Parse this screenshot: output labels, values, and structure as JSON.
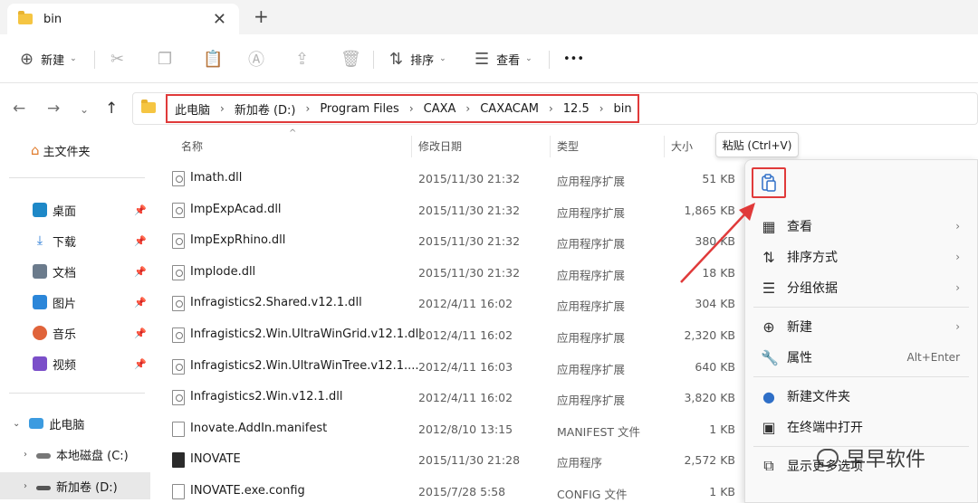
{
  "tab": {
    "title": "bin",
    "close": "✕",
    "new": "+"
  },
  "toolbar": {
    "new_label": "新建",
    "sort_label": "排序",
    "view_label": "查看",
    "more_label": "•••"
  },
  "breadcrumb": [
    "此电脑",
    "新加卷 (D:)",
    "Program Files",
    "CAXA",
    "CAXACAM",
    "12.5",
    "bin"
  ],
  "sidebar": {
    "home": "主文件夹",
    "pinned": [
      {
        "label": "桌面",
        "icon": "desktop-icon",
        "color": "#1e88c7"
      },
      {
        "label": "下载",
        "icon": "download-icon",
        "color": "#2a7bd6"
      },
      {
        "label": "文档",
        "icon": "document-icon",
        "color": "#6b7b8c"
      },
      {
        "label": "图片",
        "icon": "picture-icon",
        "color": "#2b86d9"
      },
      {
        "label": "音乐",
        "icon": "music-icon",
        "color": "#e0633a"
      },
      {
        "label": "视频",
        "icon": "video-icon",
        "color": "#7b4fc9"
      }
    ],
    "this_pc": "此电脑",
    "drives": [
      "本地磁盘 (C:)",
      "新加卷 (D:)"
    ]
  },
  "columns": {
    "name": "名称",
    "date": "修改日期",
    "type": "类型",
    "size": "大小"
  },
  "files": [
    {
      "name": "Imath.dll",
      "date": "2015/11/30 21:32",
      "type": "应用程序扩展",
      "size": "51 KB",
      "icon": "gear"
    },
    {
      "name": "ImpExpAcad.dll",
      "date": "2015/11/30 21:32",
      "type": "应用程序扩展",
      "size": "1,865 KB",
      "icon": "gear"
    },
    {
      "name": "ImpExpRhino.dll",
      "date": "2015/11/30 21:32",
      "type": "应用程序扩展",
      "size": "380 KB",
      "icon": "gear"
    },
    {
      "name": "Implode.dll",
      "date": "2015/11/30 21:32",
      "type": "应用程序扩展",
      "size": "18 KB",
      "icon": "gear"
    },
    {
      "name": "Infragistics2.Shared.v12.1.dll",
      "date": "2012/4/11 16:02",
      "type": "应用程序扩展",
      "size": "304 KB",
      "icon": "gear"
    },
    {
      "name": "Infragistics2.Win.UltraWinGrid.v12.1.dll",
      "date": "2012/4/11 16:02",
      "type": "应用程序扩展",
      "size": "2,320 KB",
      "icon": "gear"
    },
    {
      "name": "Infragistics2.Win.UltraWinTree.v12.1....",
      "date": "2012/4/11 16:03",
      "type": "应用程序扩展",
      "size": "640 KB",
      "icon": "gear"
    },
    {
      "name": "Infragistics2.Win.v12.1.dll",
      "date": "2012/4/11 16:02",
      "type": "应用程序扩展",
      "size": "3,820 KB",
      "icon": "gear"
    },
    {
      "name": "Inovate.AddIn.manifest",
      "date": "2012/8/10 13:15",
      "type": "MANIFEST 文件",
      "size": "1 KB",
      "icon": "doc"
    },
    {
      "name": "INOVATE",
      "date": "2015/11/30 21:28",
      "type": "应用程序",
      "size": "2,572 KB",
      "icon": "exe"
    },
    {
      "name": "INOVATE.exe.config",
      "date": "2015/7/28 5:58",
      "type": "CONFIG 文件",
      "size": "1 KB",
      "icon": "doc"
    }
  ],
  "context_menu": {
    "tooltip": "粘贴 (Ctrl+V)",
    "items": [
      {
        "label": "查看",
        "icon": "view-icon",
        "arrow": "›"
      },
      {
        "label": "排序方式",
        "icon": "sort-icon",
        "arrow": "›"
      },
      {
        "label": "分组依据",
        "icon": "group-icon",
        "arrow": "›"
      },
      {
        "label": "新建",
        "icon": "new-icon",
        "arrow": "›"
      },
      {
        "label": "属性",
        "icon": "properties-icon",
        "accel": "Alt+Enter"
      },
      {
        "label": "新建文件夹",
        "icon": "new-folder-icon"
      },
      {
        "label": "在终端中打开",
        "icon": "terminal-icon"
      },
      {
        "label": "显示更多选项",
        "icon": "more-options-icon"
      }
    ]
  },
  "watermark": "早早软件",
  "colors": {
    "highlight": "#e03a3a",
    "folder": "#f5c542"
  }
}
